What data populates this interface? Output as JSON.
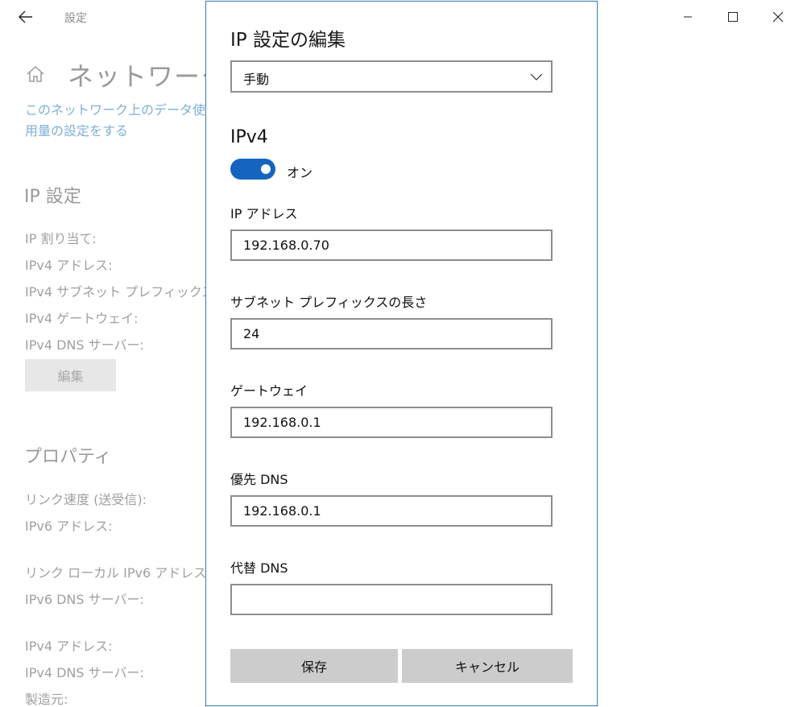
{
  "window": {
    "app_title": "設定",
    "icons": {
      "back": "back-arrow-icon",
      "minimize": "minimize-icon",
      "maximize": "maximize-icon",
      "close": "close-icon"
    }
  },
  "background": {
    "page_title": "ネットワーク",
    "data_usage_link": "このネットワーク上のデータ使用量の設定をする",
    "ip_settings": {
      "heading": "IP 設定",
      "labels": [
        "IP 割り当て:",
        "IPv4 アドレス:",
        "IPv4 サブネット プレフィックスの",
        "IPv4 ゲートウェイ:",
        "IPv4 DNS サーバー:"
      ],
      "edit_button": "編集"
    },
    "properties": {
      "heading": "プロパティ",
      "labels": [
        "リンク速度 (送受信):",
        "IPv6 アドレス:",
        "リンク ローカル IPv6 アドレス:",
        "IPv6 DNS サーバー:",
        "IPv4 アドレス:",
        "IPv4 DNS サーバー:",
        "製造元:"
      ]
    }
  },
  "dialog": {
    "title": "IP 設定の編集",
    "mode_select": {
      "value": "手動"
    },
    "ipv4": {
      "heading": "IPv4",
      "toggle_state": "オン",
      "toggle_on": true,
      "fields": {
        "ip_address": {
          "label": "IP アドレス",
          "value": "192.168.0.70"
        },
        "subnet_prefix": {
          "label": "サブネット プレフィックスの長さ",
          "value": "24"
        },
        "gateway": {
          "label": "ゲートウェイ",
          "value": "192.168.0.1"
        },
        "preferred_dns": {
          "label": "優先 DNS",
          "value": "192.168.0.1"
        },
        "alternate_dns": {
          "label": "代替 DNS",
          "value": ""
        }
      }
    },
    "buttons": {
      "save": "保存",
      "cancel": "キャンセル"
    },
    "colors": {
      "accent": "#1565c0",
      "dialog_border": "#3b7fb2",
      "input_border": "#8d8d8d",
      "button_bg": "#cccccc"
    }
  }
}
